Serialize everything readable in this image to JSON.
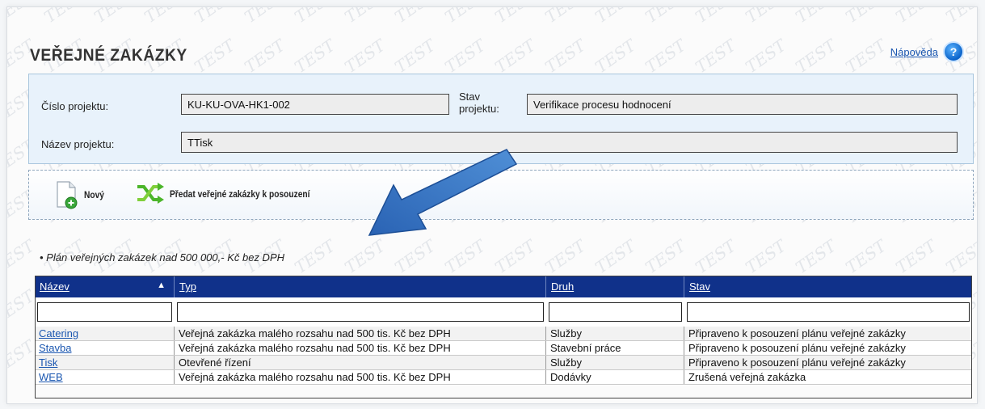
{
  "page": {
    "title": "VEŘEJNÉ ZAKÁZKY",
    "help_link": "Nápověda",
    "help_icon": "question-icon",
    "watermark_text": "TEST"
  },
  "project": {
    "number_label": "Číslo projektu:",
    "number_value": "KU-KU-OVA-HK1-002",
    "state_label": "Stav projektu:",
    "state_value": "Verifikace procesu hodnocení",
    "name_label": "Název projektu:",
    "name_value": "TTisk"
  },
  "toolbar": {
    "new_label": "Nový",
    "new_icon": "new-document-icon",
    "submit_label": "Předat veřejné zakázky k posouzení",
    "submit_icon": "shuffle-arrows-icon"
  },
  "section": {
    "bullet_text": "Plán veřejných zakázek nad 500 000,- Kč bez DPH"
  },
  "table": {
    "headers": [
      "Název",
      "Typ",
      "Druh",
      "Stav"
    ],
    "sort_indicator": "▲",
    "rows": [
      [
        "Catering",
        "Veřejná zakázka malého rozsahu nad 500 tis. Kč bez DPH",
        "Služby",
        "Připraveno k posouzení plánu veřejné zakázky"
      ],
      [
        "Stavba",
        "Veřejná zakázka malého rozsahu nad 500 tis. Kč bez DPH",
        "Stavební práce",
        "Připraveno k posouzení plánu veřejné zakázky"
      ],
      [
        "Tisk",
        "Otevřené řízení",
        "Služby",
        "Připraveno k posouzení plánu veřejné zakázky"
      ],
      [
        "WEB",
        "Veřejná zakázka malého rozsahu nad 500 tis. Kč bez DPH",
        "Dodávky",
        "Zrušená veřejná zakázka"
      ]
    ]
  },
  "colors": {
    "header_bg": "#10318a",
    "link": "#1a56b0",
    "info_bg": "#e8f2fb",
    "arrow": "#2f6fc0"
  }
}
